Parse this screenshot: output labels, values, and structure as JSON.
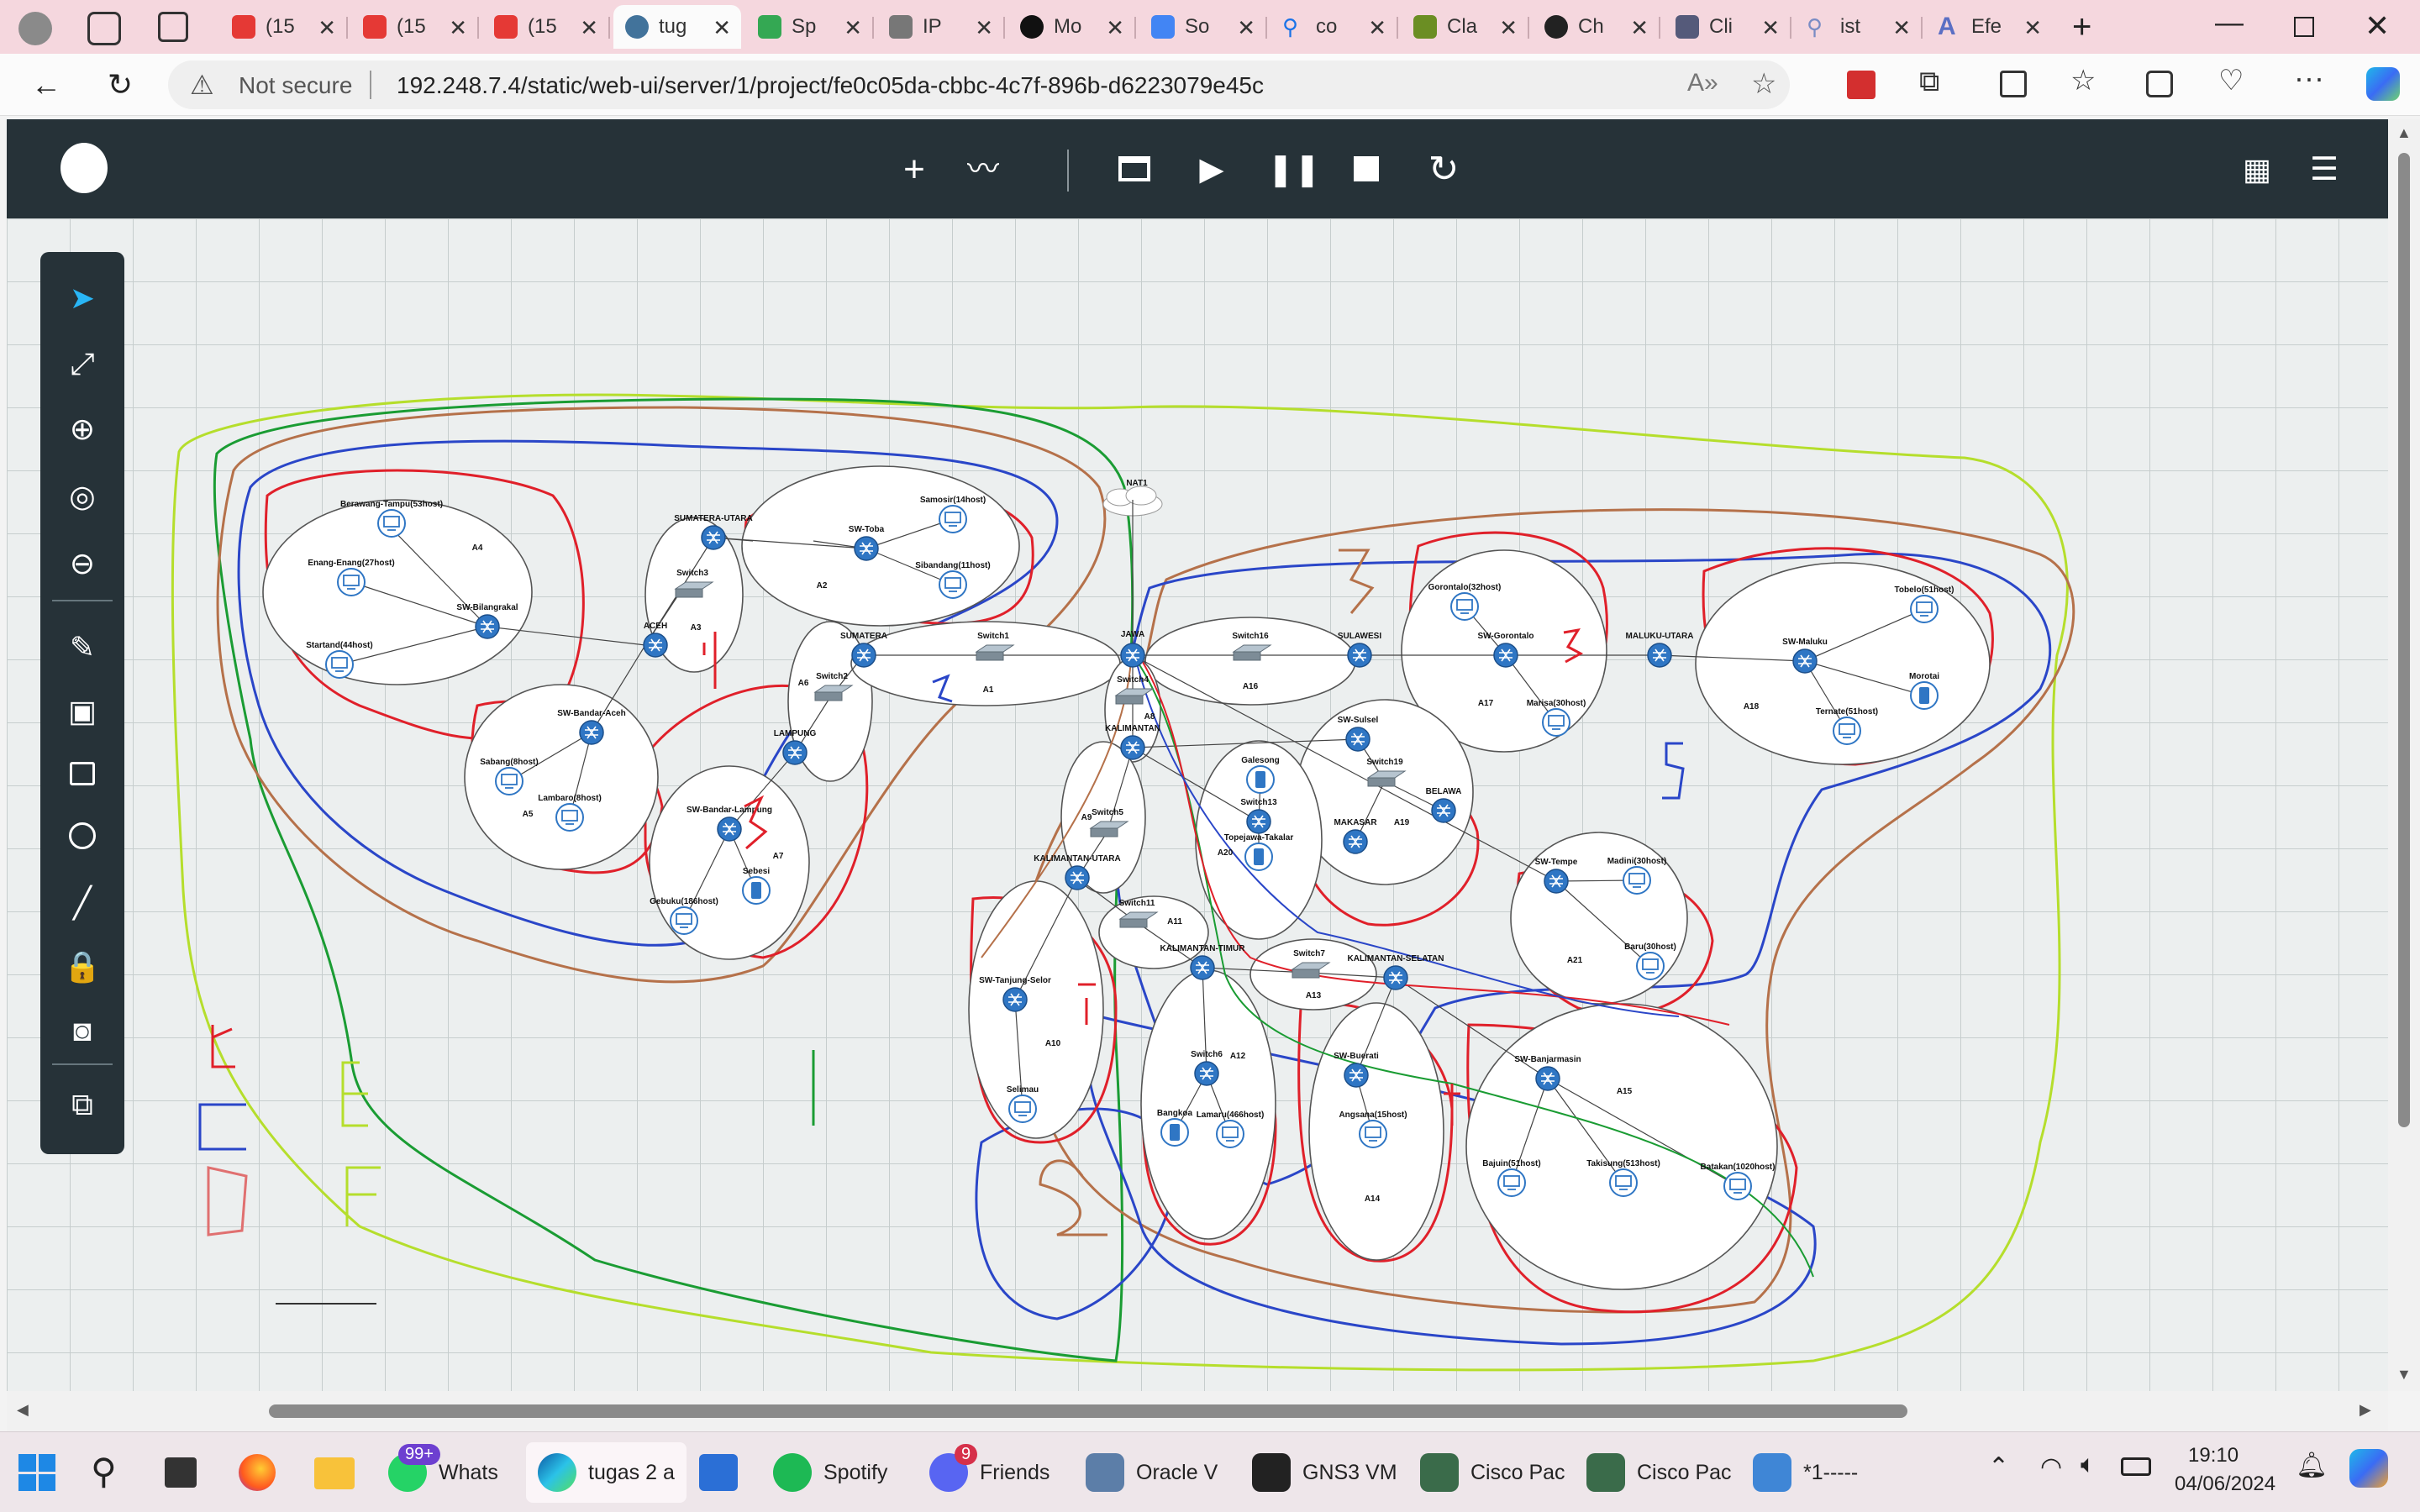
{
  "browser": {
    "tabs": [
      {
        "label": "(15",
        "icon": "youtube-icon"
      },
      {
        "label": "(15",
        "icon": "youtube-icon"
      },
      {
        "label": "(15",
        "icon": "youtube-icon"
      },
      {
        "label": "tug",
        "icon": "gns3-icon",
        "active": true
      },
      {
        "label": "Sp",
        "icon": "sheets-icon"
      },
      {
        "label": "IP",
        "icon": "calculator-icon"
      },
      {
        "label": "Mo",
        "icon": "github-icon"
      },
      {
        "label": "So",
        "icon": "docs-icon"
      },
      {
        "label": "co",
        "icon": "search-icon"
      },
      {
        "label": "Cla",
        "icon": "claude-icon"
      },
      {
        "label": "Ch",
        "icon": "chatgpt-icon"
      },
      {
        "label": "Cli",
        "icon": "perplexity-icon"
      },
      {
        "label": "ist",
        "icon": "search-icon"
      },
      {
        "label": "Efe",
        "icon": "translate-icon"
      }
    ],
    "security_label": "Not secure",
    "url": "192.248.7.4/static/web-ui/server/1/project/fe0c05da-cbbc-4c7f-896b-d6223079e45c"
  },
  "app": {
    "header_icons": [
      "add-node-icon",
      "add-link-icon",
      "console-icon",
      "start-icon",
      "pause-icon",
      "stop-icon",
      "reload-icon",
      "grid-view-icon",
      "menu-icon"
    ],
    "left_tools": [
      "select-icon",
      "fit-icon",
      "zoom-in-icon",
      "reset-zoom-icon",
      "zoom-out-icon",
      "draw-icon",
      "image-icon",
      "rectangle-icon",
      "ellipse-icon",
      "line-icon",
      "lock-icon",
      "screenshot-icon",
      "copy-icon"
    ]
  },
  "topology": {
    "areas": [
      {
        "name": "A4",
        "nodes": [
          "Berawang-Tampu(53host)",
          "Enang-Enang(27host)",
          "SW-Bilangrakal",
          "Startand(44host)"
        ]
      },
      {
        "name": "A3",
        "nodes": [
          "SUMATERA-UTARA",
          "Switch3",
          "ACEH"
        ]
      },
      {
        "name": "A2",
        "nodes": [
          "SW-Toba",
          "Samosir(14host)",
          "Sibandang(11host)"
        ]
      },
      {
        "name": "A5",
        "nodes": [
          "SW-Bandar-Aceh",
          "Sabang(8host)",
          "Lambaro(8host)"
        ]
      },
      {
        "name": "A6",
        "nodes": [
          "SUMATERA",
          "Switch2",
          "LAMPUNG"
        ]
      },
      {
        "name": "A7",
        "nodes": [
          "SW-Bandar-Lampung",
          "Sebesi",
          "Gebuku(186host)"
        ]
      },
      {
        "name": "A1",
        "nodes": [
          "Switch1"
        ]
      },
      {
        "name": "A16",
        "nodes": [
          "Switch16",
          "SULAWESI"
        ]
      },
      {
        "name": "A17",
        "nodes": [
          "Gorontalo(32host)",
          "SW-Gorontalo",
          "Marisa(30host)"
        ]
      },
      {
        "name": "A18",
        "nodes": [
          "MALUKU-UTARA",
          "SW-Maluku",
          "Tobelo(51host)",
          "Morotai",
          "Ternate(51host)"
        ]
      },
      {
        "name": "A8",
        "nodes": [
          "Switch4",
          "KALIMANTAN"
        ]
      },
      {
        "name": "A9",
        "nodes": [
          "Switch5",
          "KALIMANTAN-UTARA"
        ]
      },
      {
        "name": "A19",
        "nodes": [
          "SW-Sulsel",
          "Switch19",
          "BELAWA",
          "MAKASAR"
        ]
      },
      {
        "name": "A20",
        "nodes": [
          "Galesong",
          "Switch13",
          "Topejawa-Takalar"
        ]
      },
      {
        "name": "A21",
        "nodes": [
          "SW-Tempe",
          "Madini(30host)",
          "Baru(30host)"
        ]
      },
      {
        "name": "A10",
        "nodes": [
          "SW-Tanjung-Selor",
          "Selimau"
        ]
      },
      {
        "name": "A11",
        "nodes": [
          "Switch11",
          "KALIMANTAN-TIMUR"
        ]
      },
      {
        "name": "A12",
        "nodes": [
          "Switch6",
          "Bangkoa",
          "Lamaru(466host)"
        ]
      },
      {
        "name": "A13",
        "nodes": [
          "Switch7",
          "KALIMANTAN-SELATAN"
        ]
      },
      {
        "name": "A14",
        "nodes": [
          "SW-Buerati",
          "Angsana(15host)"
        ]
      },
      {
        "name": "A15",
        "nodes": [
          "SW-Banjarmasin",
          "Bajuin(51host)",
          "Takisung(513host)",
          "Batakan(1020host)"
        ]
      }
    ],
    "core_labels": [
      "NAT1",
      "JAWA"
    ]
  },
  "taskbar": {
    "apps": [
      {
        "label": "Whats",
        "badge": "99+"
      },
      {
        "label": "tugas 2 a"
      },
      {
        "label": "Spotify"
      },
      {
        "label": "Friends",
        "badge": "9"
      },
      {
        "label": "Oracle V"
      },
      {
        "label": "GNS3 VM"
      },
      {
        "label": "Cisco Pac"
      },
      {
        "label": "Cisco Pac"
      },
      {
        "label": "*1-----"
      }
    ],
    "time": "19:10",
    "date": "04/06/2024"
  }
}
